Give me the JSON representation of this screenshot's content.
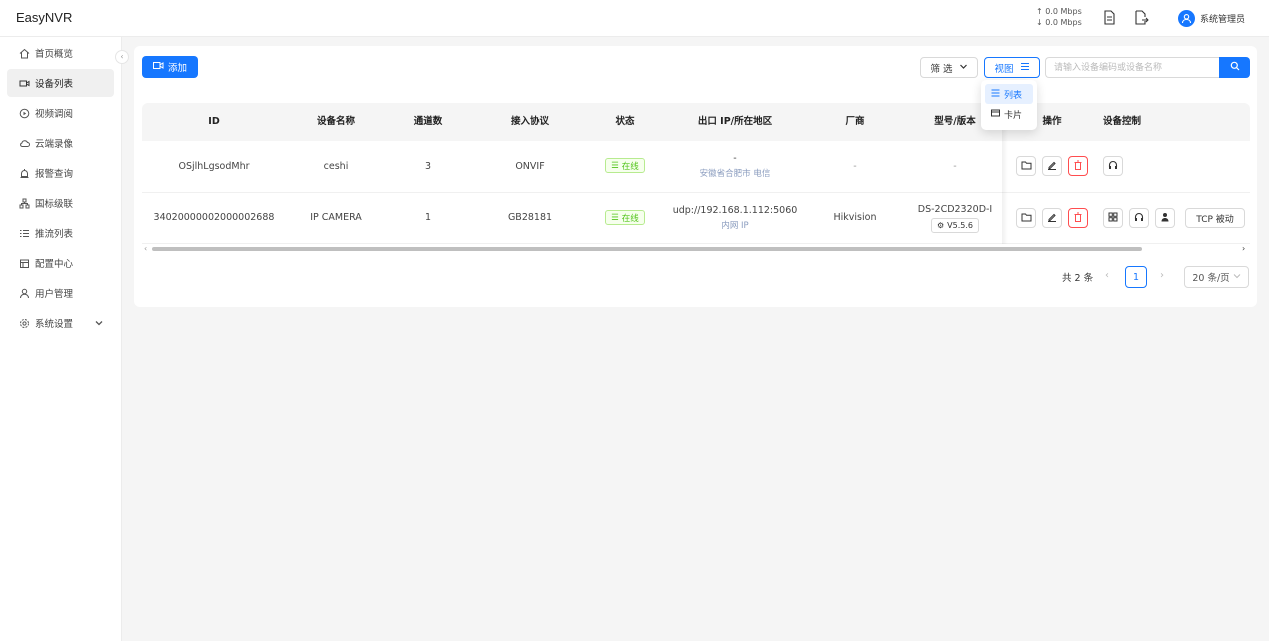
{
  "app": {
    "title": "EasyNVR"
  },
  "header": {
    "upload_rate": "↑ 0.0 Mbps",
    "download_rate": "↓ 0.0 Mbps",
    "user_name": "系统管理员"
  },
  "sidebar": {
    "items": [
      {
        "label": "首页概览",
        "icon": "home-icon"
      },
      {
        "label": "设备列表",
        "icon": "camera-icon",
        "active": true
      },
      {
        "label": "视频调阅",
        "icon": "play-circle-icon"
      },
      {
        "label": "云端录像",
        "icon": "cloud-icon"
      },
      {
        "label": "报警查询",
        "icon": "alarm-icon"
      },
      {
        "label": "国标级联",
        "icon": "cascade-icon"
      },
      {
        "label": "推流列表",
        "icon": "list-icon"
      },
      {
        "label": "配置中心",
        "icon": "config-icon"
      },
      {
        "label": "用户管理",
        "icon": "user-icon"
      },
      {
        "label": "系统设置",
        "icon": "settings-icon"
      }
    ]
  },
  "toolbar": {
    "add_label": "添加",
    "filter_label": "筛 选",
    "view_label": "视图",
    "search_placeholder": "请输入设备编码或设备名称"
  },
  "view_menu": {
    "items": [
      {
        "label": "列表",
        "active": true
      },
      {
        "label": "卡片",
        "active": false
      }
    ]
  },
  "table": {
    "columns": [
      "ID",
      "设备名称",
      "通道数",
      "接入协议",
      "状态",
      "出口 IP/所在地区",
      "厂商",
      "型号/版本",
      "操作",
      "设备控制"
    ],
    "rows": [
      {
        "id": "OSjlhLgsodMhr",
        "name": "ceshi",
        "channels": "3",
        "protocol": "ONVIF",
        "status": "在线",
        "ip": "-",
        "region": "安徽省合肥市 电信",
        "vendor": "-",
        "model": "-",
        "version": ""
      },
      {
        "id": "34020000002000002688",
        "name": "IP CAMERA",
        "channels": "1",
        "protocol": "GB28181",
        "status": "在线",
        "ip": "udp://192.168.1.112:5060",
        "region": "内网 IP",
        "vendor": "Hikvision",
        "model": "DS-2CD2320D-I",
        "version": "V5.5.6",
        "tcp_label": "TCP 被动"
      }
    ]
  },
  "pagination": {
    "total": "共 2 条",
    "current": "1",
    "page_size": "20 条/页"
  },
  "colors": {
    "primary": "#1677ff",
    "success": "#52c41a",
    "danger": "#ff4d4f"
  }
}
